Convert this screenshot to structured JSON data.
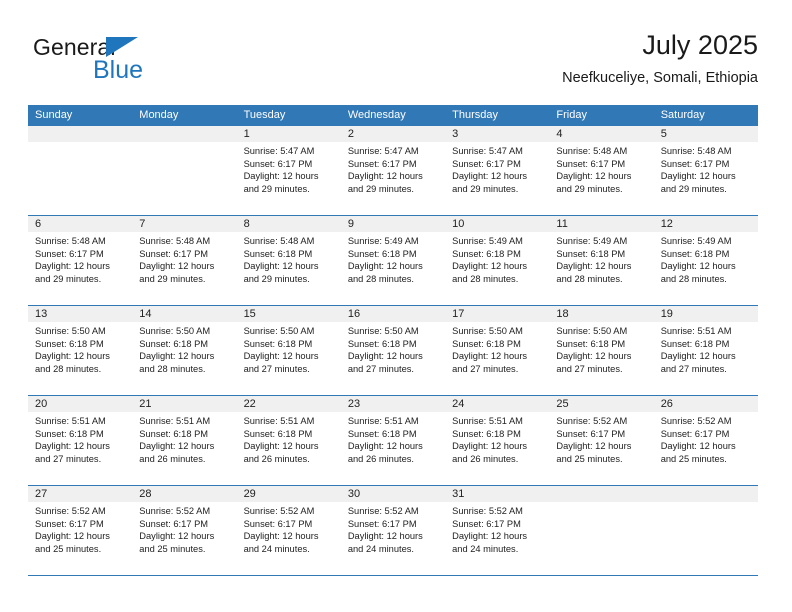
{
  "brand": {
    "name_top": "General",
    "name_bottom": "Blue",
    "accent_color": "#1f76bd"
  },
  "header": {
    "title": "July 2025",
    "subtitle": "Neefkuceliye, Somali, Ethiopia"
  },
  "calendar": {
    "header_bg": "#3178b6",
    "day_band_bg": "#f0f0f0",
    "weekdays": [
      "Sunday",
      "Monday",
      "Tuesday",
      "Wednesday",
      "Thursday",
      "Friday",
      "Saturday"
    ],
    "weeks": [
      [
        {
          "date": "",
          "sunrise": "",
          "sunset": "",
          "daylight1": "",
          "daylight2": ""
        },
        {
          "date": "",
          "sunrise": "",
          "sunset": "",
          "daylight1": "",
          "daylight2": ""
        },
        {
          "date": "1",
          "sunrise": "Sunrise: 5:47 AM",
          "sunset": "Sunset: 6:17 PM",
          "daylight1": "Daylight: 12 hours",
          "daylight2": "and 29 minutes."
        },
        {
          "date": "2",
          "sunrise": "Sunrise: 5:47 AM",
          "sunset": "Sunset: 6:17 PM",
          "daylight1": "Daylight: 12 hours",
          "daylight2": "and 29 minutes."
        },
        {
          "date": "3",
          "sunrise": "Sunrise: 5:47 AM",
          "sunset": "Sunset: 6:17 PM",
          "daylight1": "Daylight: 12 hours",
          "daylight2": "and 29 minutes."
        },
        {
          "date": "4",
          "sunrise": "Sunrise: 5:48 AM",
          "sunset": "Sunset: 6:17 PM",
          "daylight1": "Daylight: 12 hours",
          "daylight2": "and 29 minutes."
        },
        {
          "date": "5",
          "sunrise": "Sunrise: 5:48 AM",
          "sunset": "Sunset: 6:17 PM",
          "daylight1": "Daylight: 12 hours",
          "daylight2": "and 29 minutes."
        }
      ],
      [
        {
          "date": "6",
          "sunrise": "Sunrise: 5:48 AM",
          "sunset": "Sunset: 6:17 PM",
          "daylight1": "Daylight: 12 hours",
          "daylight2": "and 29 minutes."
        },
        {
          "date": "7",
          "sunrise": "Sunrise: 5:48 AM",
          "sunset": "Sunset: 6:17 PM",
          "daylight1": "Daylight: 12 hours",
          "daylight2": "and 29 minutes."
        },
        {
          "date": "8",
          "sunrise": "Sunrise: 5:48 AM",
          "sunset": "Sunset: 6:18 PM",
          "daylight1": "Daylight: 12 hours",
          "daylight2": "and 29 minutes."
        },
        {
          "date": "9",
          "sunrise": "Sunrise: 5:49 AM",
          "sunset": "Sunset: 6:18 PM",
          "daylight1": "Daylight: 12 hours",
          "daylight2": "and 28 minutes."
        },
        {
          "date": "10",
          "sunrise": "Sunrise: 5:49 AM",
          "sunset": "Sunset: 6:18 PM",
          "daylight1": "Daylight: 12 hours",
          "daylight2": "and 28 minutes."
        },
        {
          "date": "11",
          "sunrise": "Sunrise: 5:49 AM",
          "sunset": "Sunset: 6:18 PM",
          "daylight1": "Daylight: 12 hours",
          "daylight2": "and 28 minutes."
        },
        {
          "date": "12",
          "sunrise": "Sunrise: 5:49 AM",
          "sunset": "Sunset: 6:18 PM",
          "daylight1": "Daylight: 12 hours",
          "daylight2": "and 28 minutes."
        }
      ],
      [
        {
          "date": "13",
          "sunrise": "Sunrise: 5:50 AM",
          "sunset": "Sunset: 6:18 PM",
          "daylight1": "Daylight: 12 hours",
          "daylight2": "and 28 minutes."
        },
        {
          "date": "14",
          "sunrise": "Sunrise: 5:50 AM",
          "sunset": "Sunset: 6:18 PM",
          "daylight1": "Daylight: 12 hours",
          "daylight2": "and 28 minutes."
        },
        {
          "date": "15",
          "sunrise": "Sunrise: 5:50 AM",
          "sunset": "Sunset: 6:18 PM",
          "daylight1": "Daylight: 12 hours",
          "daylight2": "and 27 minutes."
        },
        {
          "date": "16",
          "sunrise": "Sunrise: 5:50 AM",
          "sunset": "Sunset: 6:18 PM",
          "daylight1": "Daylight: 12 hours",
          "daylight2": "and 27 minutes."
        },
        {
          "date": "17",
          "sunrise": "Sunrise: 5:50 AM",
          "sunset": "Sunset: 6:18 PM",
          "daylight1": "Daylight: 12 hours",
          "daylight2": "and 27 minutes."
        },
        {
          "date": "18",
          "sunrise": "Sunrise: 5:50 AM",
          "sunset": "Sunset: 6:18 PM",
          "daylight1": "Daylight: 12 hours",
          "daylight2": "and 27 minutes."
        },
        {
          "date": "19",
          "sunrise": "Sunrise: 5:51 AM",
          "sunset": "Sunset: 6:18 PM",
          "daylight1": "Daylight: 12 hours",
          "daylight2": "and 27 minutes."
        }
      ],
      [
        {
          "date": "20",
          "sunrise": "Sunrise: 5:51 AM",
          "sunset": "Sunset: 6:18 PM",
          "daylight1": "Daylight: 12 hours",
          "daylight2": "and 27 minutes."
        },
        {
          "date": "21",
          "sunrise": "Sunrise: 5:51 AM",
          "sunset": "Sunset: 6:18 PM",
          "daylight1": "Daylight: 12 hours",
          "daylight2": "and 26 minutes."
        },
        {
          "date": "22",
          "sunrise": "Sunrise: 5:51 AM",
          "sunset": "Sunset: 6:18 PM",
          "daylight1": "Daylight: 12 hours",
          "daylight2": "and 26 minutes."
        },
        {
          "date": "23",
          "sunrise": "Sunrise: 5:51 AM",
          "sunset": "Sunset: 6:18 PM",
          "daylight1": "Daylight: 12 hours",
          "daylight2": "and 26 minutes."
        },
        {
          "date": "24",
          "sunrise": "Sunrise: 5:51 AM",
          "sunset": "Sunset: 6:18 PM",
          "daylight1": "Daylight: 12 hours",
          "daylight2": "and 26 minutes."
        },
        {
          "date": "25",
          "sunrise": "Sunrise: 5:52 AM",
          "sunset": "Sunset: 6:17 PM",
          "daylight1": "Daylight: 12 hours",
          "daylight2": "and 25 minutes."
        },
        {
          "date": "26",
          "sunrise": "Sunrise: 5:52 AM",
          "sunset": "Sunset: 6:17 PM",
          "daylight1": "Daylight: 12 hours",
          "daylight2": "and 25 minutes."
        }
      ],
      [
        {
          "date": "27",
          "sunrise": "Sunrise: 5:52 AM",
          "sunset": "Sunset: 6:17 PM",
          "daylight1": "Daylight: 12 hours",
          "daylight2": "and 25 minutes."
        },
        {
          "date": "28",
          "sunrise": "Sunrise: 5:52 AM",
          "sunset": "Sunset: 6:17 PM",
          "daylight1": "Daylight: 12 hours",
          "daylight2": "and 25 minutes."
        },
        {
          "date": "29",
          "sunrise": "Sunrise: 5:52 AM",
          "sunset": "Sunset: 6:17 PM",
          "daylight1": "Daylight: 12 hours",
          "daylight2": "and 24 minutes."
        },
        {
          "date": "30",
          "sunrise": "Sunrise: 5:52 AM",
          "sunset": "Sunset: 6:17 PM",
          "daylight1": "Daylight: 12 hours",
          "daylight2": "and 24 minutes."
        },
        {
          "date": "31",
          "sunrise": "Sunrise: 5:52 AM",
          "sunset": "Sunset: 6:17 PM",
          "daylight1": "Daylight: 12 hours",
          "daylight2": "and 24 minutes."
        },
        {
          "date": "",
          "sunrise": "",
          "sunset": "",
          "daylight1": "",
          "daylight2": ""
        },
        {
          "date": "",
          "sunrise": "",
          "sunset": "",
          "daylight1": "",
          "daylight2": ""
        }
      ]
    ]
  }
}
